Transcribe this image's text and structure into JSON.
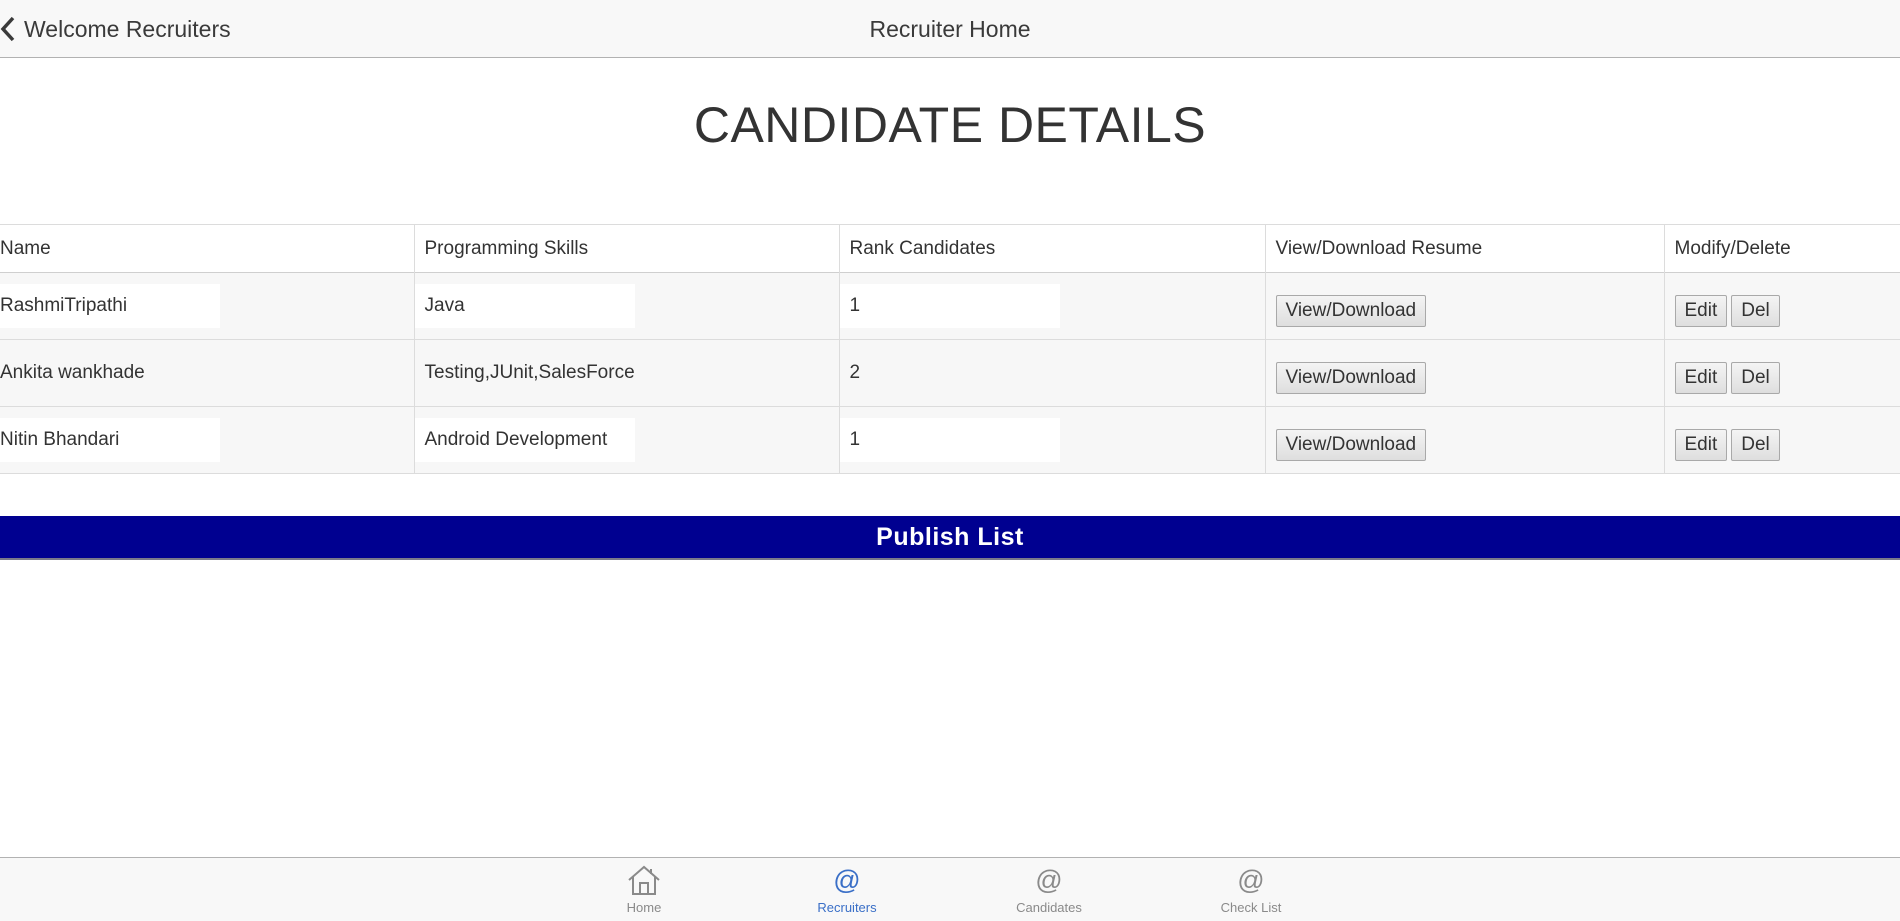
{
  "navbar": {
    "back_label": "Welcome Recruiters",
    "title": "Recruiter Home"
  },
  "page": {
    "heading": "CANDIDATE DETAILS"
  },
  "table": {
    "headers": [
      "Name",
      "Programming Skills",
      "Rank Candidates",
      "View/Download Resume",
      "Modify/Delete"
    ],
    "rows": [
      {
        "name": "RashmiTripathi",
        "skills": "Java",
        "rank": "1",
        "view_label": "View/Download",
        "edit_label": "Edit",
        "del_label": "Del",
        "boxed": true
      },
      {
        "name": "Ankita wankhade",
        "skills": "Testing,JUnit,SalesForce",
        "rank": "2",
        "view_label": "View/Download",
        "edit_label": "Edit",
        "del_label": "Del",
        "boxed": false
      },
      {
        "name": "Nitin Bhandari",
        "skills": "Android Development",
        "rank": "1",
        "view_label": "View/Download",
        "edit_label": "Edit",
        "del_label": "Del",
        "boxed": true
      }
    ]
  },
  "publish": {
    "label": "Publish List",
    "color": "#000090"
  },
  "tabbar": {
    "active_color": "#3a6fc7",
    "tabs": [
      {
        "label": "Home",
        "icon": "home-icon"
      },
      {
        "label": "Recruiters",
        "icon": "at-icon",
        "active": true
      },
      {
        "label": "Candidates",
        "icon": "at-icon"
      },
      {
        "label": "Check List",
        "icon": "at-icon"
      }
    ],
    "at_glyph": "@"
  }
}
